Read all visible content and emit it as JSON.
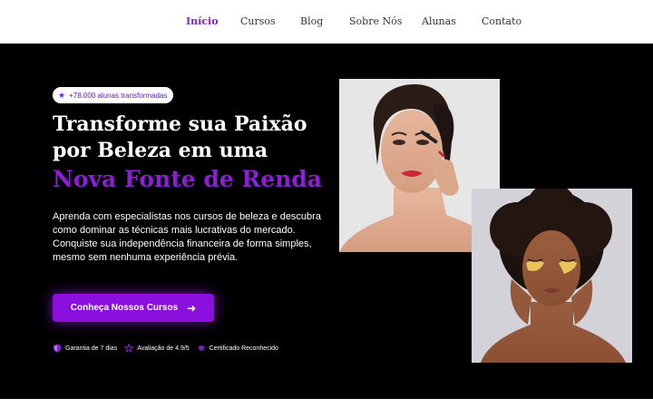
{
  "nav": {
    "items": [
      {
        "label": "Início",
        "active": true
      },
      {
        "label": "Cursos",
        "active": false
      },
      {
        "label": "Blog",
        "active": false
      },
      {
        "label": "Sobre Nós",
        "active": false
      },
      {
        "label": "Alunas",
        "active": false
      },
      {
        "label": "Contato",
        "active": false
      }
    ]
  },
  "hero": {
    "badge": {
      "icon": "star-icon",
      "text": "+78.000 alunas transformadas"
    },
    "title_line1": "Transforme sua Paixão",
    "title_line2": "por Beleza em uma",
    "title_accent": "Nova Fonte de Renda",
    "description": "Aprenda com especialistas nos cursos de beleza e descubra como dominar as técnicas mais lucrativas do mercado. Conquiste sua independência financeira de forma simples, mesmo sem nenhuma experiência prévia.",
    "cta": {
      "label": "Conheça Nossos Cursos",
      "icon": "arrow-right-icon"
    },
    "features": [
      {
        "icon": "shield-icon",
        "text": "Garantia de 7 dias"
      },
      {
        "icon": "star-outline-icon",
        "text": "Avaliação de 4.9/5"
      },
      {
        "icon": "graduation-cap-icon",
        "text": "Certificado Reconhecido"
      }
    ]
  },
  "colors": {
    "accent": "#8b1fd6",
    "button": "#8b10dd",
    "hero_background": "#000000",
    "nav_background": "#ffffff"
  }
}
